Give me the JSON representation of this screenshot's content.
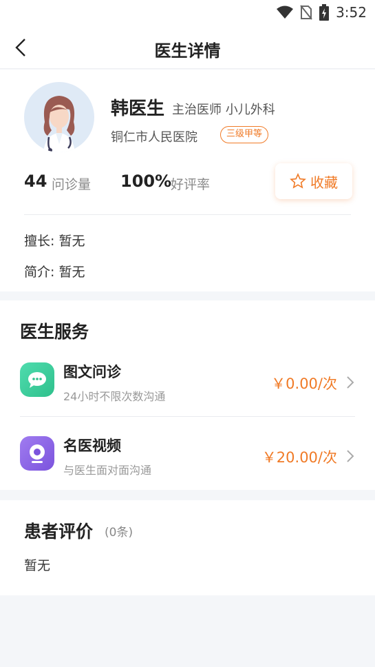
{
  "status_bar": {
    "time": "3:52",
    "icons": [
      "wifi-icon",
      "no-sim-icon",
      "battery-charging-icon"
    ]
  },
  "nav": {
    "title": "医生详情",
    "back_icon": "chevron-left-icon"
  },
  "doctor": {
    "name": "韩医生",
    "title_dept": "主治医师  小儿外科",
    "hospital": "铜仁市人民医院",
    "grade": "三级甲等",
    "consult_count": "44",
    "consult_label": "问诊量",
    "rating": "100%",
    "rating_label": "好评率",
    "favorite_label": "收藏",
    "specialty": "擅长: 暂无",
    "intro": "简介: 暂无"
  },
  "services": {
    "title": "医生服务",
    "items": [
      {
        "name": "图文问诊",
        "desc": "24小时不限次数沟通",
        "price": "￥0.00/次",
        "icon": "chat-bubble-icon",
        "color": "#3dcf9c"
      },
      {
        "name": "名医视频",
        "desc": "与医生面对面沟通",
        "price": "￥20.00/次",
        "icon": "video-camera-icon",
        "color": "#8b63e6"
      }
    ]
  },
  "reviews": {
    "title": "患者评价",
    "count": "(0条)",
    "empty": "暂无"
  },
  "colors": {
    "accent": "#f07a26",
    "background": "#f4f6f9"
  }
}
